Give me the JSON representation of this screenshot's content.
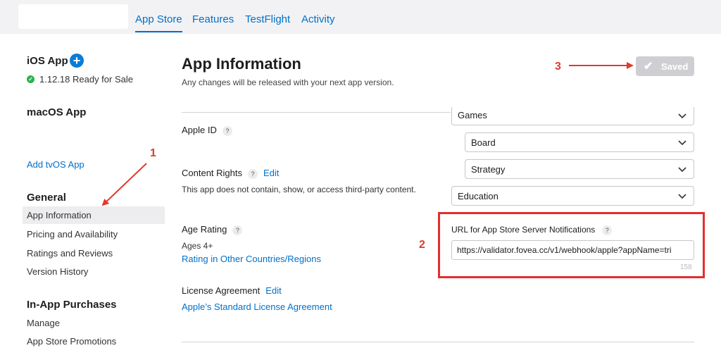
{
  "nav": {
    "tabs": [
      "App Store",
      "Features",
      "TestFlight",
      "Activity"
    ],
    "active": "App Store"
  },
  "sidebar": {
    "ios_app": {
      "title": "iOS App",
      "status": "1.12.18 Ready for Sale"
    },
    "macos_app": {
      "title": "macOS App"
    },
    "add_tvos": "Add tvOS App",
    "general": {
      "heading": "General",
      "items": [
        "App Information",
        "Pricing and Availability",
        "Ratings and Reviews",
        "Version History"
      ],
      "selected": "App Information"
    },
    "iap": {
      "heading": "In-App Purchases",
      "items": [
        "Manage",
        "App Store Promotions"
      ]
    }
  },
  "main": {
    "title": "App Information",
    "subtitle": "Any changes will be released with your next app version.",
    "save_button": "Saved",
    "apple_id": {
      "label": "Apple ID",
      "help": "?"
    },
    "content_rights": {
      "label": "Content Rights",
      "help": "?",
      "edit": "Edit",
      "text": "This app does not contain, show, or access third-party content."
    },
    "age_rating": {
      "label": "Age Rating",
      "help": "?",
      "value": "Ages 4+",
      "link": "Rating in Other Countries/Regions"
    },
    "license": {
      "label": "License Agreement",
      "edit": "Edit",
      "link": "Apple’s Standard License Agreement"
    },
    "category_selects": [
      "Games",
      "Board",
      "Strategy",
      "Education"
    ],
    "url_field": {
      "label": "URL for App Store Server Notifications",
      "help": "?",
      "value": "https://validator.fovea.cc/v1/webhook/apple?appName=tri",
      "char_count": "158"
    }
  },
  "annotations": [
    "1",
    "2",
    "3"
  ],
  "colors": {
    "accent": "#0070c9",
    "annotation_red": "#e52d2d",
    "ready_green": "#2bb24c",
    "disabled_button": "#cfcfd3"
  }
}
